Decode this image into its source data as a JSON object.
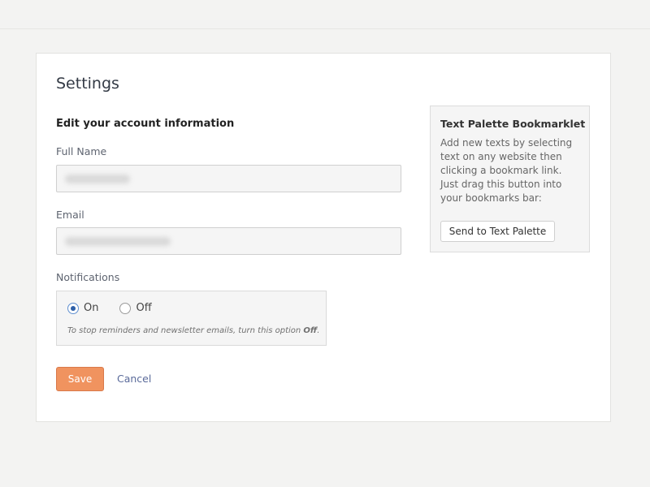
{
  "page": {
    "title": "Settings",
    "section_heading": "Edit your account information"
  },
  "form": {
    "full_name": {
      "label": "Full Name",
      "value": ""
    },
    "email": {
      "label": "Email",
      "value": ""
    },
    "notifications": {
      "label": "Notifications",
      "options": [
        {
          "label": "On",
          "selected": true
        },
        {
          "label": "Off",
          "selected": false
        }
      ],
      "hint_prefix": "To stop reminders and newsletter emails, turn this option ",
      "hint_emphasis": "Off",
      "hint_suffix": "."
    },
    "save_label": "Save",
    "cancel_label": "Cancel"
  },
  "sidebar": {
    "title": "Text Palette Bookmarklet",
    "lines": [
      "Add new texts by selecting",
      "text on any website then",
      "clicking a bookmark link.",
      "Just drag this button into",
      "your bookmarks bar:"
    ],
    "button_label": "Send to Text Palette"
  },
  "colors": {
    "accent": "#f0935f",
    "link": "#5a6a9a",
    "background": "#f3f3f2"
  }
}
